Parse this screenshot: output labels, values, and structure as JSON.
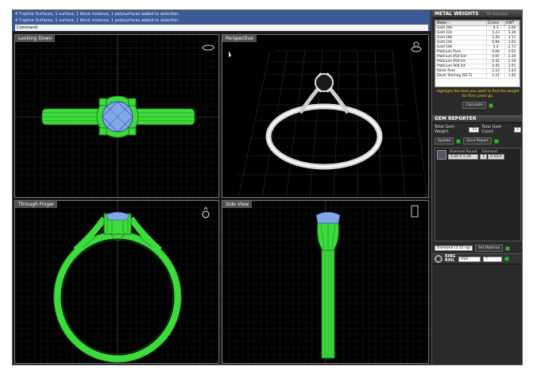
{
  "command_line": {
    "lines": [
      "4 T-spline Surfaces, 1 surface, 1 block instance, 1 polysurfaces added to selection.",
      "4 T-spline Surfaces, 1 surface, 1 block instance, 1 polysurfaces added to selection."
    ],
    "prompt": "Command:"
  },
  "viewports": {
    "top": "Looking Down",
    "perspective": "Perspective",
    "front": "Through Finger",
    "side": "Side View"
  },
  "metal_weights": {
    "title": "METAL WEIGHTS",
    "subtitle": "Fit Selected Checked",
    "columns": [
      "Metal",
      "Grams",
      "DWT"
    ],
    "rows": [
      [
        "Gold 24k",
        "4.3",
        "2.64"
      ],
      [
        "Gold 22k",
        "5.23",
        "3.36"
      ],
      [
        "Gold 18k",
        "5.26",
        "3.11"
      ],
      [
        "Gold 14k",
        "4.84",
        "3.01"
      ],
      [
        "Gold 10k",
        "5.3",
        "2.71"
      ],
      [
        "Platinum Pure",
        "4.06",
        "2.61"
      ],
      [
        "Platinum 950 Iird",
        "4.97",
        "2.34"
      ],
      [
        "Platinum 950 Ird",
        "4.35",
        "2.59"
      ],
      [
        "Platinum 900 Ird",
        "4.45",
        "2.91"
      ],
      [
        "Silver Pure",
        "2.23",
        "1.43"
      ],
      [
        "Silver Sterling (92.5)",
        "2.21",
        "1.42"
      ]
    ],
    "hint": "Highlight the item you want to find the weight for then press go.",
    "calculate_label": "Calculate"
  },
  "gem_reporter": {
    "title": "GEM REPORTER",
    "total_weight_label": "Total Gem Weight",
    "total_weight_value": ".51",
    "total_count_label": "Total Gem Count",
    "total_count_value": "1",
    "update_label": "Update",
    "save_report_label": "Save Report",
    "gem": {
      "shape_header": "Diamond Round",
      "size": "5.20 X 5.20",
      "type_header": "Diamond",
      "count": "1",
      "weight": "0.51ct"
    },
    "material_select": "Diamond",
    "material_value": "(3.52 sg)",
    "set_material_label": "Set Material"
  },
  "ring_rail": {
    "label": "RING RAIL",
    "region": "USA",
    "size": "7"
  },
  "colors": {
    "wire_green": "#3cdc3c",
    "gem_blue": "#7fa8e8",
    "grid": "#2c2c2c",
    "command_bg": "#3c5a96",
    "hint_yellow": "#ffd21a"
  }
}
